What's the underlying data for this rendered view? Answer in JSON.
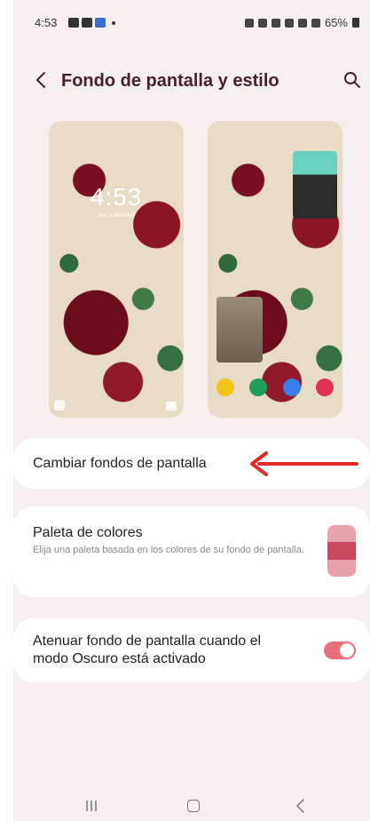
{
  "status_bar": {
    "time": "4:53",
    "battery": "65%"
  },
  "header": {
    "title": "Fondo de pantalla y estilo"
  },
  "previews": {
    "lock": {
      "clock": "4:53",
      "date": "mar, 6 de mayo"
    }
  },
  "change_wallpaper": {
    "label": "Cambiar fondos de pantalla"
  },
  "palette": {
    "title": "Paleta de colores",
    "description": "Elija una paleta basada en los colores de su fondo de pantalla.",
    "swatches": [
      "#e9a3ad",
      "#c94a5c",
      "#e8a0ab"
    ]
  },
  "dim": {
    "label": "Atenuar fondo de pantalla cuando el modo Oscuro está activado",
    "enabled": true
  },
  "colors": {
    "title": "#4a2028",
    "accent_toggle": "#e8707e",
    "annotation_arrow": "#e02a2a",
    "background": "#f6efef"
  },
  "icons": {
    "back": "chevron-left-icon",
    "search": "search-icon",
    "nav_recent": "recent-apps-icon",
    "nav_home": "home-icon",
    "nav_back": "back-icon"
  }
}
